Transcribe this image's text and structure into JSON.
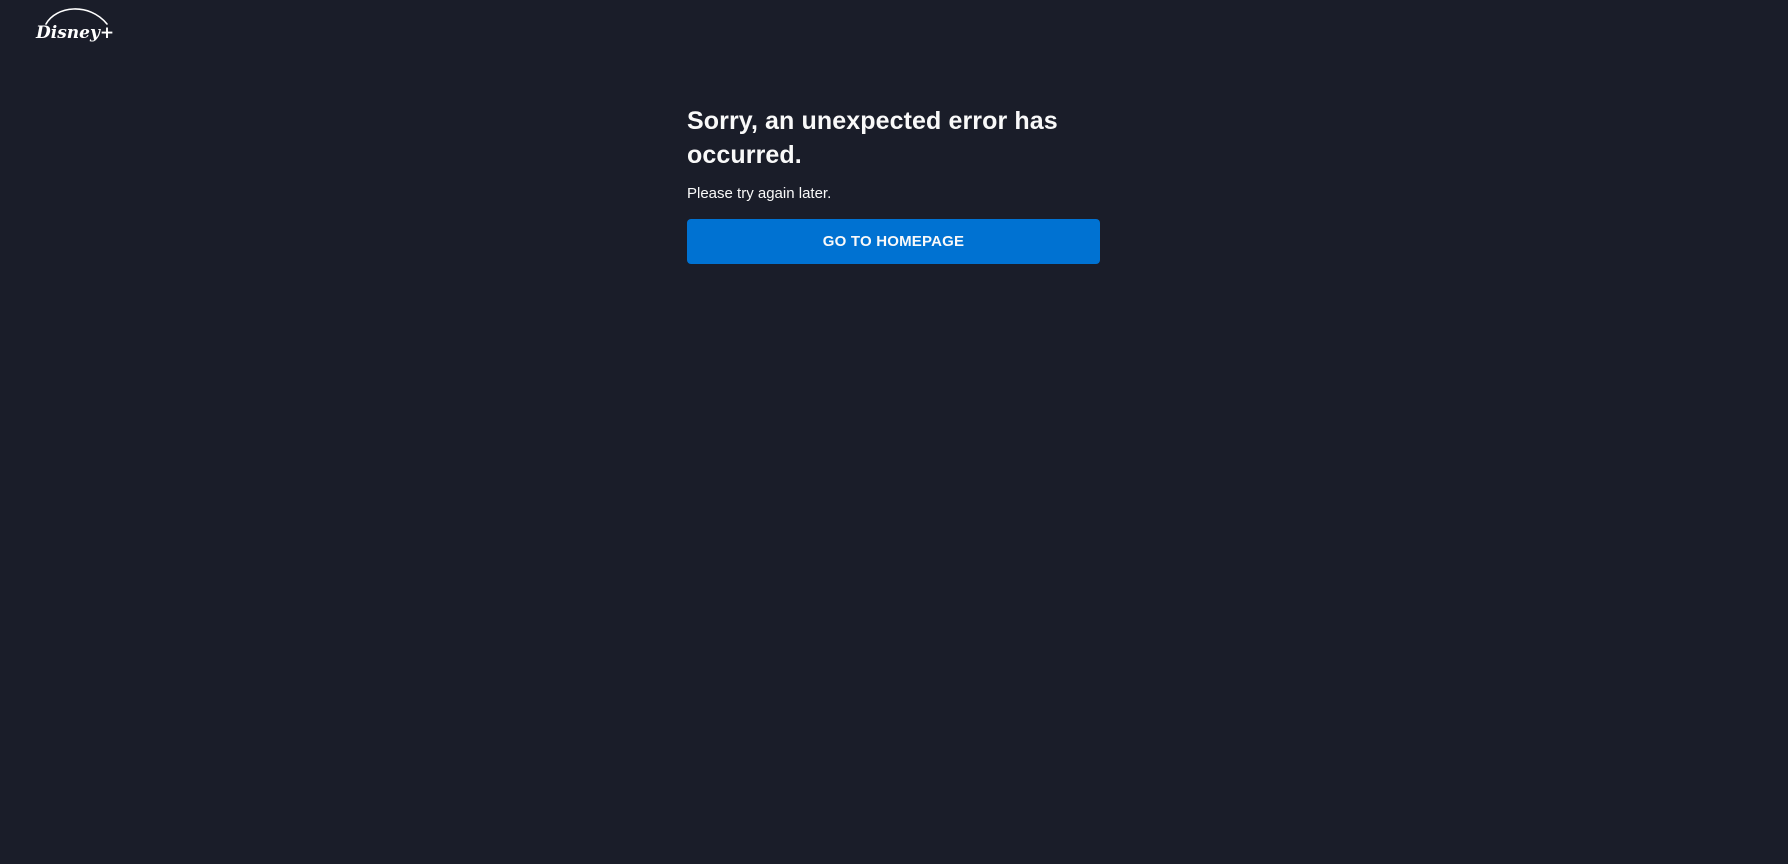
{
  "brand": {
    "logo_text": "Disney+",
    "logo_icon": "disney-plus-logo"
  },
  "error": {
    "title": "Sorry, an unexpected error has occurred.",
    "message": "Please try again later.",
    "button_label": "GO TO HOMEPAGE"
  },
  "colors": {
    "background": "#1a1d29",
    "text": "#f9f9f9",
    "button_accent": "#0072d2"
  }
}
